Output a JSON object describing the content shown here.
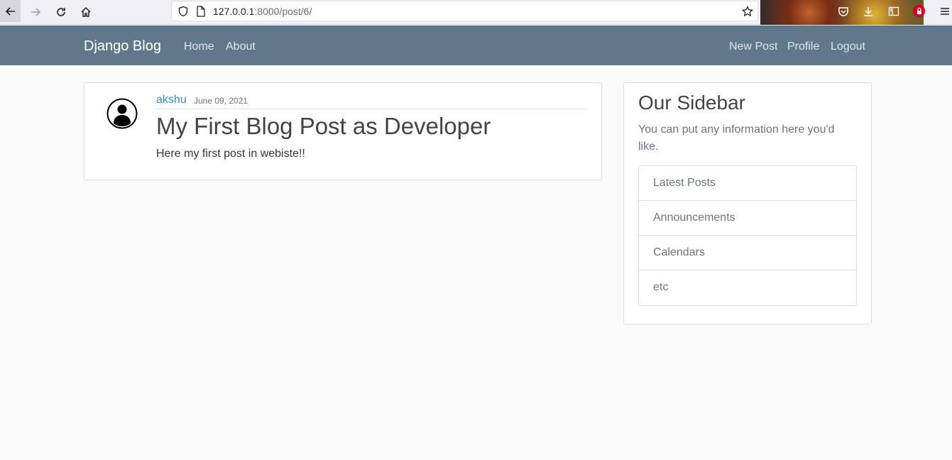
{
  "browser": {
    "url_host": "127.0.0.1",
    "url_rest": ":8000/post/6/"
  },
  "navbar": {
    "brand": "Django Blog",
    "left_links": [
      "Home",
      "About"
    ],
    "right_links": [
      "New Post",
      "Profile",
      "Logout"
    ],
    "background_color": "#5f788a"
  },
  "post": {
    "author": "akshu",
    "date": "June 09, 2021",
    "title": "My First Blog Post as Developer",
    "content": "Here my first post in webiste!!",
    "avatar_icon": "user-avatar-icon",
    "author_color": "#3e8acc"
  },
  "sidebar": {
    "title": "Our Sidebar",
    "text": "You can put any information here you'd like.",
    "items": [
      "Latest Posts",
      "Announcements",
      "Calendars",
      "etc"
    ]
  }
}
